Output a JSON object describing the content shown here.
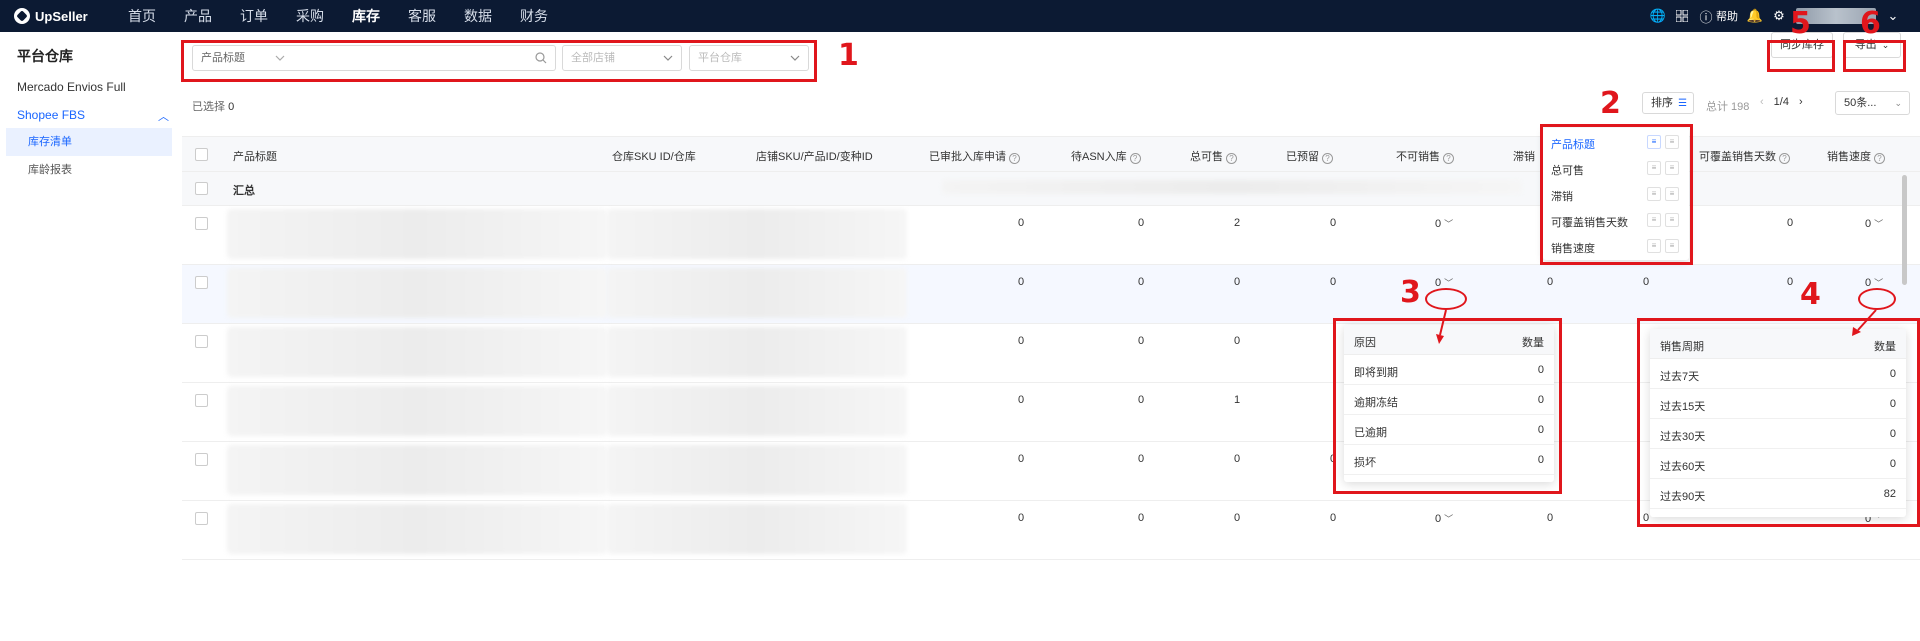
{
  "topbar": {
    "logo": "UpSeller",
    "nav": [
      "首页",
      "产品",
      "订单",
      "采购",
      "库存",
      "客服",
      "数据",
      "财务"
    ],
    "active_nav": "库存",
    "help": "帮助"
  },
  "sidebar": {
    "title": "平台仓库",
    "items": [
      {
        "label": "Mercado Envios Full"
      },
      {
        "label": "Shopee FBS"
      }
    ],
    "subitems": [
      {
        "label": "库存清单",
        "active": true
      },
      {
        "label": "库龄报表",
        "active": false
      }
    ]
  },
  "filters": {
    "field_select": "产品标题",
    "search_value": "",
    "store_placeholder": "全部店铺",
    "warehouse_placeholder": "平台仓库",
    "sync_button": "同步库存",
    "export_button": "导出"
  },
  "toolbar": {
    "selected_label": "已选择",
    "selected_count": "0",
    "sort_label": "排序",
    "total": "总计 198",
    "page": "1/4",
    "page_size": "50条..."
  },
  "table": {
    "columns": [
      "产品标题",
      "仓库SKU ID/仓库",
      "店铺SKU/产品ID/变种ID",
      "已审批入库申请",
      "待ASN入库",
      "总可售",
      "已预留",
      "不可销售",
      "滞销",
      "可覆盖销售天数",
      "销售速度"
    ],
    "summary_label": "汇总",
    "rows": [
      {
        "approved": "0",
        "asn": "0",
        "total_sale": "2",
        "reserved": "0",
        "unsellable": "0",
        "slow": "",
        "days": "0",
        "speed": "0"
      },
      {
        "approved": "0",
        "asn": "0",
        "total_sale": "0",
        "reserved": "0",
        "unsellable": "0",
        "slow": "0",
        "days": "0",
        "speed": "0"
      },
      {
        "approved": "0",
        "asn": "0",
        "total_sale": "0",
        "reserved": "",
        "unsellable": "",
        "slow": "",
        "days": "",
        "speed": ""
      },
      {
        "approved": "0",
        "asn": "0",
        "total_sale": "1",
        "reserved": "",
        "unsellable": "",
        "slow": "",
        "days": "",
        "speed": ""
      },
      {
        "approved": "0",
        "asn": "0",
        "total_sale": "0",
        "reserved": "0",
        "unsellable": "0",
        "slow": "0",
        "days": "",
        "speed": ""
      },
      {
        "approved": "0",
        "asn": "0",
        "total_sale": "0",
        "reserved": "0",
        "unsellable": "0",
        "slow": "0",
        "days": "0",
        "speed": "0"
      }
    ]
  },
  "sort_menu": [
    "产品标题",
    "总可售",
    "滞销",
    "可覆盖销售天数",
    "销售速度"
  ],
  "unsellable_popup": {
    "headers": [
      "原因",
      "数量"
    ],
    "rows": [
      {
        "label": "即将到期",
        "value": "0"
      },
      {
        "label": "逾期冻结",
        "value": "0"
      },
      {
        "label": "已逾期",
        "value": "0"
      },
      {
        "label": "损坏",
        "value": "0"
      }
    ]
  },
  "speed_popup": {
    "headers": [
      "销售周期",
      "数量"
    ],
    "rows": [
      {
        "label": "过去7天",
        "value": "0"
      },
      {
        "label": "过去15天",
        "value": "0"
      },
      {
        "label": "过去30天",
        "value": "0"
      },
      {
        "label": "过去60天",
        "value": "0"
      },
      {
        "label": "过去90天",
        "value": "82"
      }
    ]
  },
  "annotations": [
    "1",
    "2",
    "3",
    "4",
    "5",
    "6"
  ],
  "colors": {
    "topbar": "#0c1a33",
    "accent": "#1a66ff",
    "annotation": "#e0161c"
  }
}
